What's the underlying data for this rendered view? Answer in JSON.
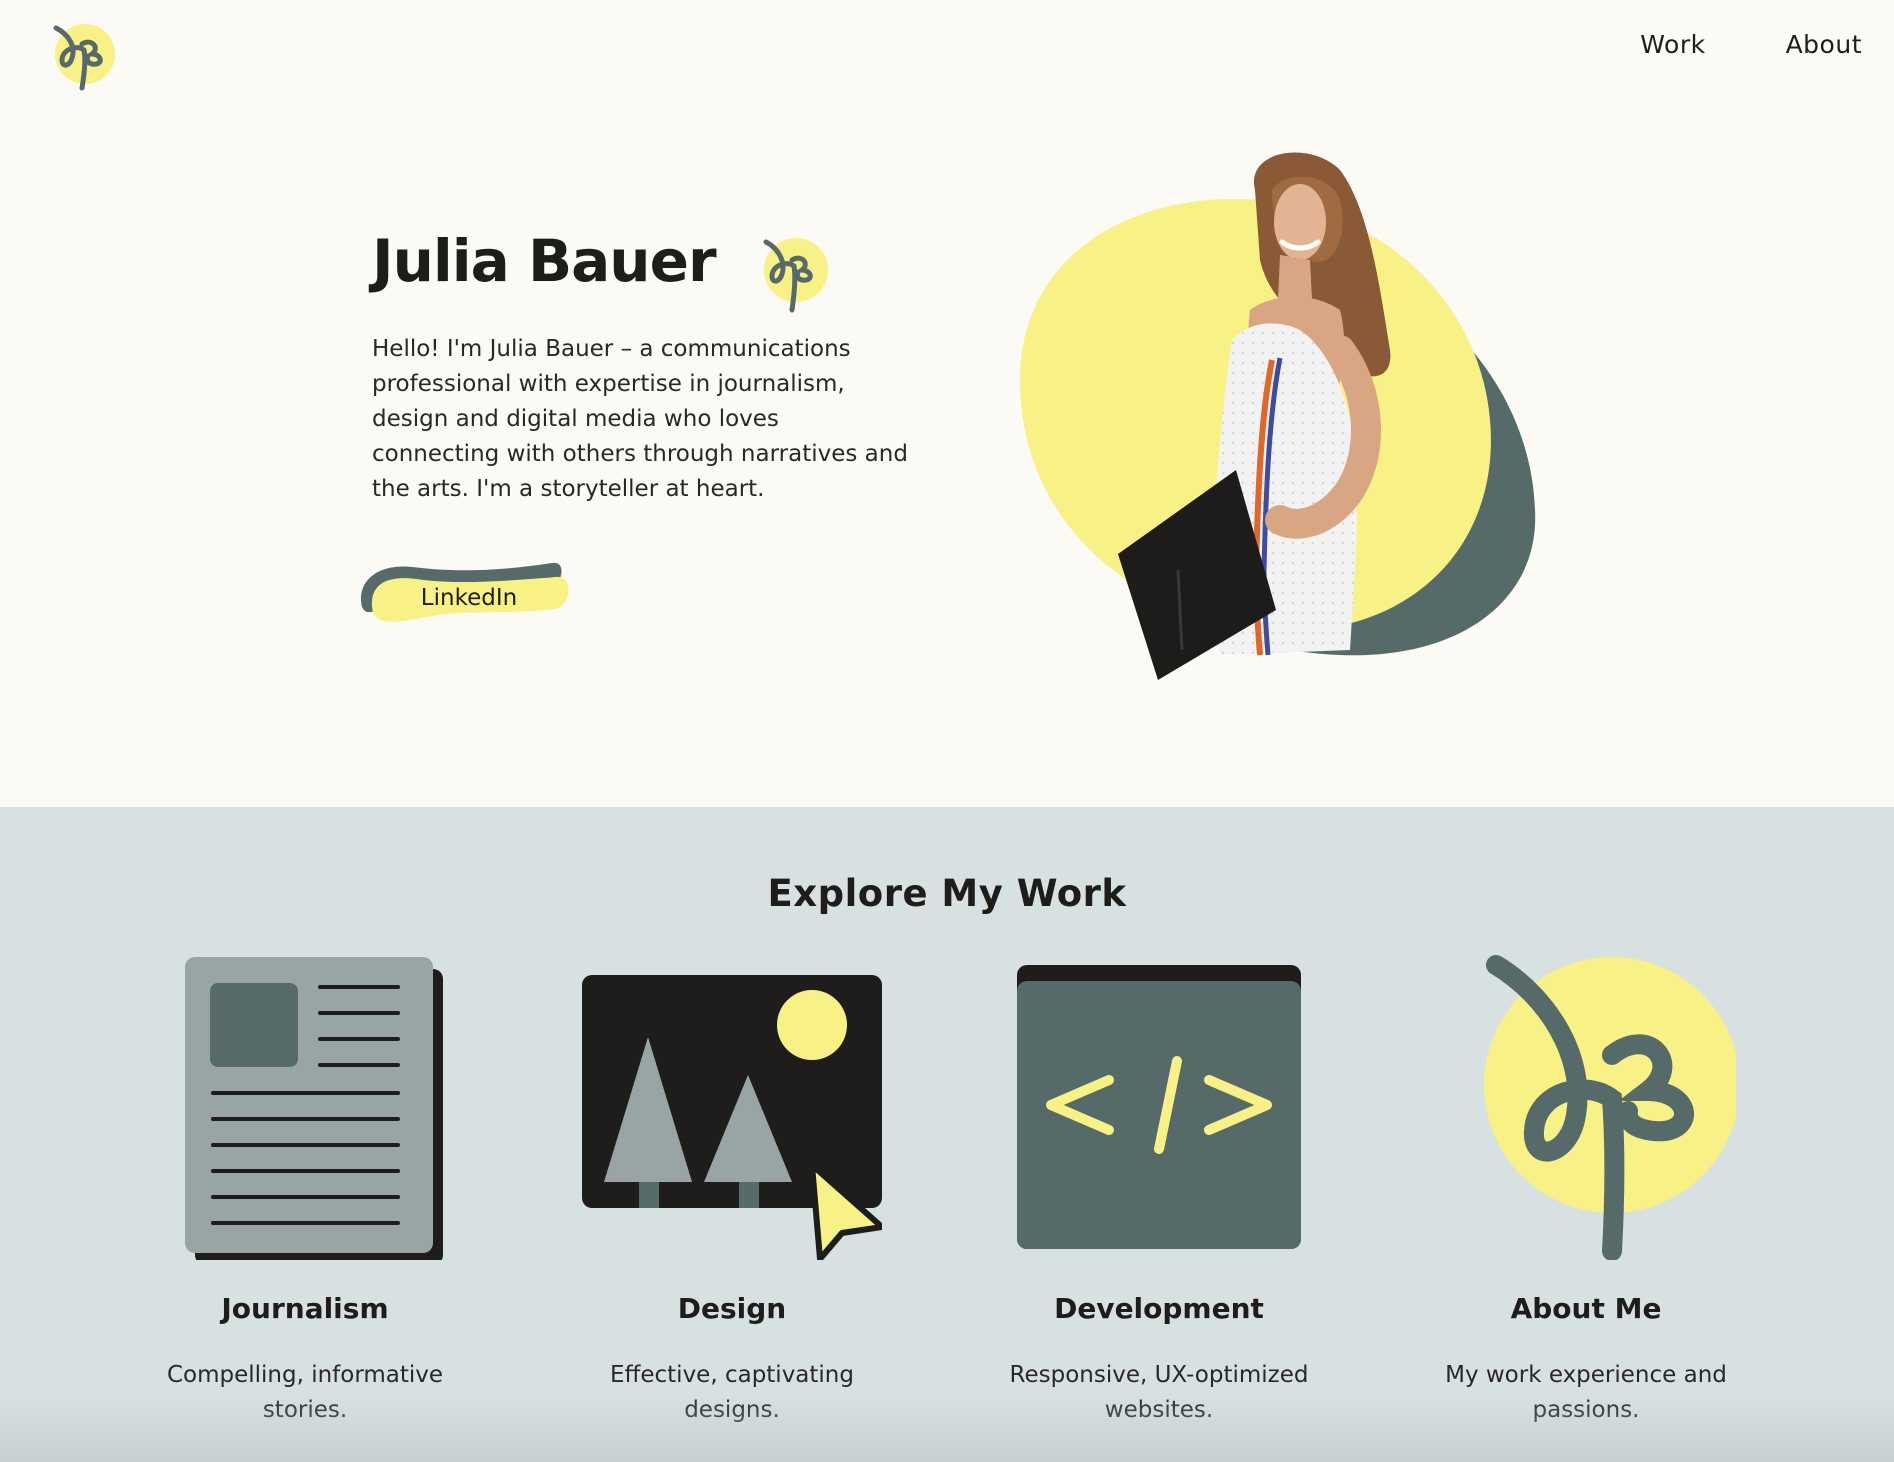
{
  "brand": {
    "logo_icon": "jb-monogram-icon",
    "accent": "#F8F185",
    "slate": "#566B69",
    "dark": "#1F1D1B"
  },
  "nav": {
    "items": [
      {
        "label": "Work"
      },
      {
        "label": "About"
      }
    ]
  },
  "hero": {
    "name": "Julia Bauer",
    "bio": "Hello! I'm Julia Bauer – a communications professional with expertise in journalism, design and digital media who loves connecting with others through narratives and the arts. I'm a storyteller at heart.",
    "button_label": "LinkedIn",
    "photo": "portrait-graduation-photo"
  },
  "work": {
    "title": "Explore My Work",
    "cards": [
      {
        "title": "Journalism",
        "description": "Compelling, informative stories.",
        "icon": "newspaper-icon"
      },
      {
        "title": "Design",
        "description": "Effective, captivating designs.",
        "icon": "image-cursor-icon"
      },
      {
        "title": "Development",
        "description": "Responsive, UX-optimized websites.",
        "icon": "code-window-icon"
      },
      {
        "title": "About Me",
        "description": "My work experience and passions.",
        "icon": "jb-monogram-icon"
      }
    ]
  }
}
